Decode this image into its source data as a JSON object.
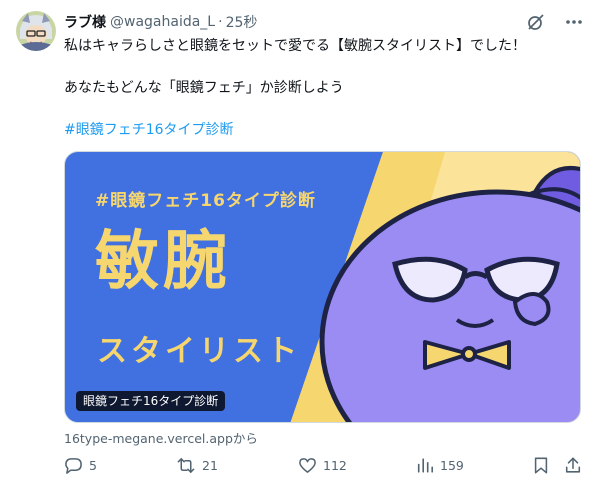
{
  "tweet": {
    "display_name": "ラブ様",
    "handle": "@wagahaida_L",
    "separator": "·",
    "time": "25秒",
    "text_line1": "私はキャラらしさと眼鏡をセットで愛でる【敏腕スタイリスト】でした！",
    "text_line2": "あなたもどんな「眼鏡フェチ」か診断しよう",
    "hashtag": "#眼鏡フェチ16タイプ診断"
  },
  "card": {
    "tag": "#眼鏡フェチ16タイプ診断",
    "title": "敏腕",
    "subtitle": "スタイリスト",
    "label": "眼鏡フェチ16タイプ診断",
    "source": "16type-megane.vercel.appから"
  },
  "actions": {
    "replies": "5",
    "reposts": "21",
    "likes": "112",
    "views": "159"
  },
  "icons": {
    "grok": "grok-icon",
    "more": "more-dots-icon",
    "reply": "reply-icon",
    "repost": "repost-icon",
    "like": "heart-icon",
    "views": "views-chart-icon",
    "bookmark": "bookmark-icon",
    "share": "share-icon"
  },
  "colors": {
    "link": "#1d9bf0",
    "secondary_text": "#536471",
    "card_blue": "#4170e0",
    "card_yellow": "#f6d66e",
    "character_purple": "#9b8cf4"
  }
}
